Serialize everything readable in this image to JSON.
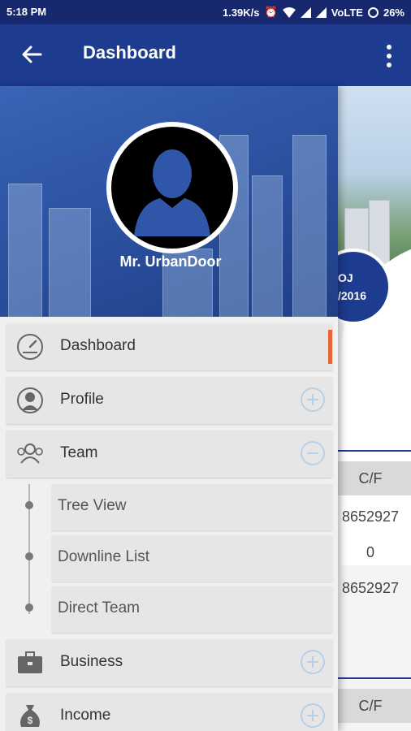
{
  "status_bar": {
    "time": "5:18 PM",
    "network_speed": "1.39K/s",
    "network_type": "VoLTE",
    "battery": "26%"
  },
  "app_bar": {
    "title": "Dashboard",
    "back_icon": "arrow-left-icon",
    "menu_icon": "more-vert-icon"
  },
  "drawer": {
    "user_name": "Mr. UrbanDoor",
    "items": [
      {
        "label": "Dashboard",
        "icon": "speedometer-icon",
        "active": true
      },
      {
        "label": "Profile",
        "icon": "user-circle-icon",
        "action": "expand"
      },
      {
        "label": "Team",
        "icon": "group-icon",
        "action": "collapse"
      },
      {
        "label": "Business",
        "icon": "briefcase-icon",
        "action": "expand"
      },
      {
        "label": "Income",
        "icon": "money-bag-icon",
        "action": "expand"
      }
    ],
    "team_subitems": [
      {
        "label": "Tree View"
      },
      {
        "label": "Downline List"
      },
      {
        "label": "Direct Team"
      }
    ]
  },
  "background": {
    "date_line1": "OJ",
    "date_line2": "/2016",
    "table1": {
      "header": "C/F",
      "values": [
        "8652927",
        "0",
        "8652927"
      ]
    },
    "table2": {
      "header": "C/F"
    }
  },
  "colors": {
    "primary": "#1d3b8f",
    "status_bar": "#17286e",
    "accent": "#e8643a",
    "drawer_item": "#e6e6e6"
  }
}
